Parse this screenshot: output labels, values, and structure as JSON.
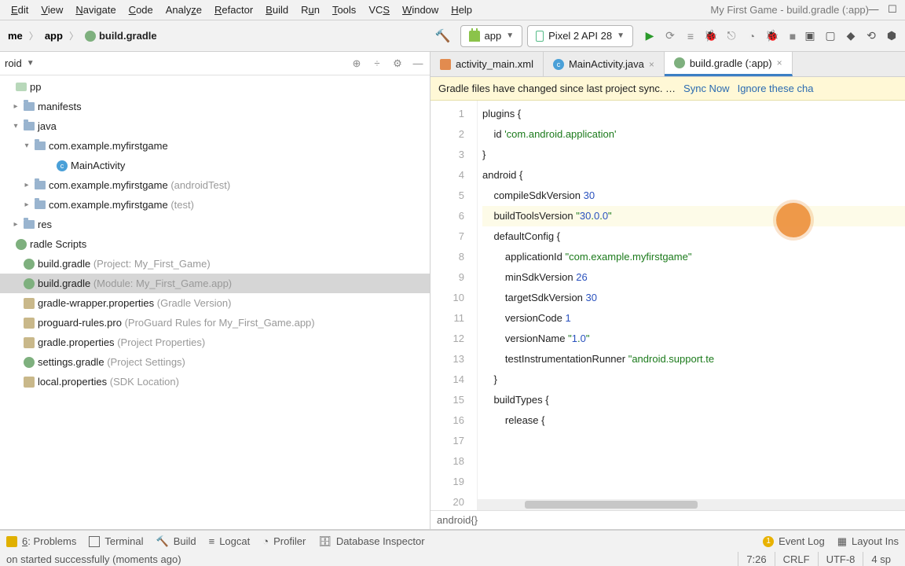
{
  "window": {
    "title": "My First Game - build.gradle (:app)"
  },
  "menu": {
    "items": [
      "Edit",
      "View",
      "Navigate",
      "Code",
      "Analyze",
      "Refactor",
      "Build",
      "Run",
      "Tools",
      "VCS",
      "Window",
      "Help"
    ]
  },
  "breadcrumb": {
    "root": "me",
    "module": "app",
    "file": "build.gradle"
  },
  "selectors": {
    "config": "app",
    "device": "Pixel 2 API 28"
  },
  "projectHeader": {
    "view": "roid"
  },
  "tree": {
    "app": "pp",
    "manifests": "manifests",
    "java": "java",
    "pkg_main": "com.example.myfirstgame",
    "main_activity": "MainActivity",
    "pkg_androidTest": "com.example.myfirstgame",
    "pkg_androidTest_suffix": "(androidTest)",
    "pkg_test": "com.example.myfirstgame",
    "pkg_test_suffix": "(test)",
    "res": "res",
    "gradle_scripts": "radle Scripts",
    "bg_project": "build.gradle",
    "bg_project_suffix": "(Project: My_First_Game)",
    "bg_module": "build.gradle",
    "bg_module_suffix": "(Module: My_First_Game.app)",
    "gw_props": "gradle-wrapper.properties",
    "gw_props_suffix": "(Gradle Version)",
    "proguard": "proguard-rules.pro",
    "proguard_suffix": "(ProGuard Rules for My_First_Game.app)",
    "gradle_props": "gradle.properties",
    "gradle_props_suffix": "(Project Properties)",
    "settings": "settings.gradle",
    "settings_suffix": "(Project Settings)",
    "local": "local.properties",
    "local_suffix": "(SDK Location)"
  },
  "tabs": {
    "t1": "activity_main.xml",
    "t2": "MainActivity.java",
    "t3": "build.gradle (:app)"
  },
  "banner": {
    "msg": "Gradle files have changed since last project sync. …",
    "link1": "Sync Now",
    "link2": "Ignore these cha"
  },
  "code": {
    "lines": [
      "plugins {",
      "    id 'com.android.application'",
      "}",
      "",
      "android {",
      "    compileSdkVersion 30",
      "    buildToolsVersion \"30.0.0\"",
      "",
      "    defaultConfig {",
      "        applicationId \"com.example.myfirstgame\"",
      "        minSdkVersion 26",
      "        targetSdkVersion 30",
      "        versionCode 1",
      "        versionName \"1.0\"",
      "",
      "        testInstrumentationRunner \"android.support.te",
      "    }",
      "",
      "    buildTypes {",
      "        release {"
    ],
    "crumb": "android{}"
  },
  "bottom": {
    "problems": "6: Problems",
    "terminal": "Terminal",
    "build": "Build",
    "logcat": "Logcat",
    "profiler": "Profiler",
    "db": "Database Inspector",
    "eventlog": "Event Log",
    "layout": "Layout Ins"
  },
  "status": {
    "msg": "on started successfully (moments ago)",
    "pos": "7:26",
    "eol": "CRLF",
    "enc": "UTF-8",
    "indent": "4 sp"
  }
}
